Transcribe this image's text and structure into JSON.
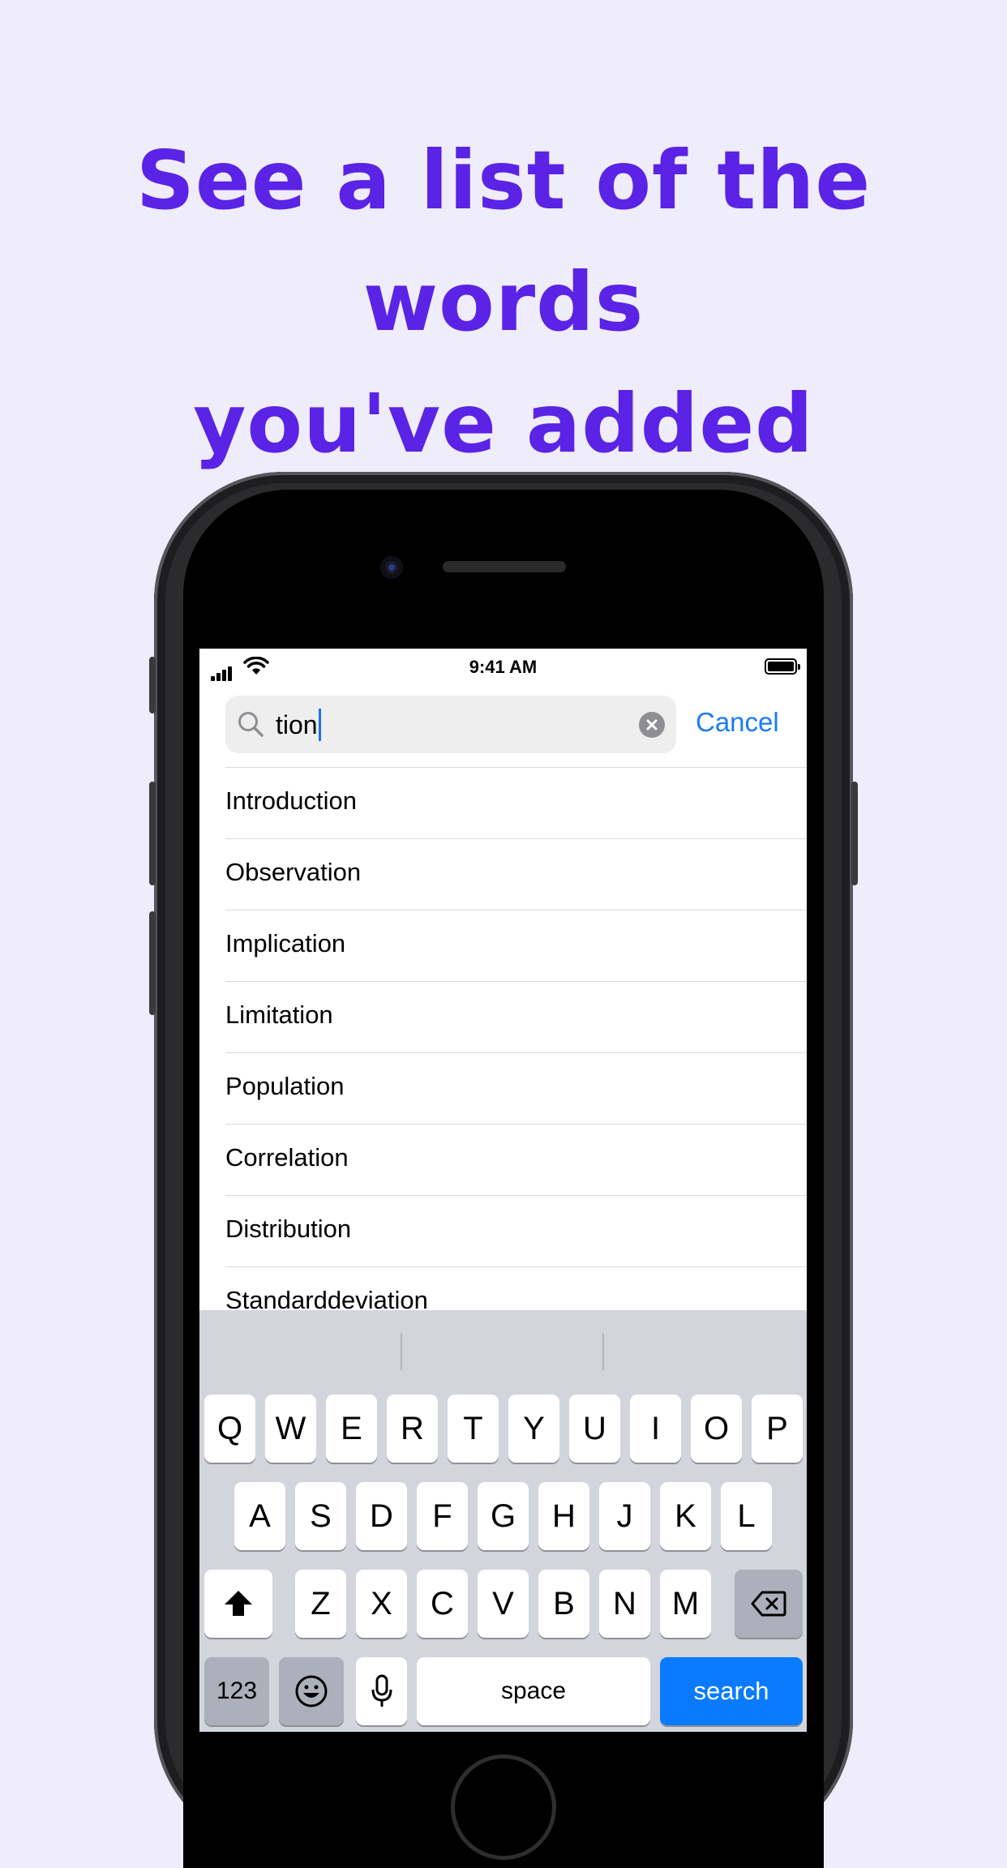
{
  "headline": [
    "See a list of the words",
    "you've added"
  ],
  "status": {
    "time": "9:41 AM"
  },
  "search": {
    "query": "tion",
    "cancel_label": "Cancel"
  },
  "words": [
    "Introduction",
    "Observation",
    "Implication",
    "Limitation",
    "Population",
    "Correlation",
    "Distribution",
    "Standarddeviation"
  ],
  "keyboard": {
    "row1": [
      "Q",
      "W",
      "E",
      "R",
      "T",
      "Y",
      "U",
      "I",
      "O",
      "P"
    ],
    "row2": [
      "A",
      "S",
      "D",
      "F",
      "G",
      "H",
      "J",
      "K",
      "L"
    ],
    "row3": [
      "Z",
      "X",
      "C",
      "V",
      "B",
      "N",
      "M"
    ],
    "numbers_label": "123",
    "space_label": "space",
    "search_label": "search"
  },
  "colors": {
    "headline": "#5a23e6",
    "accent": "#0a7bfe",
    "background": "#efecfb"
  }
}
